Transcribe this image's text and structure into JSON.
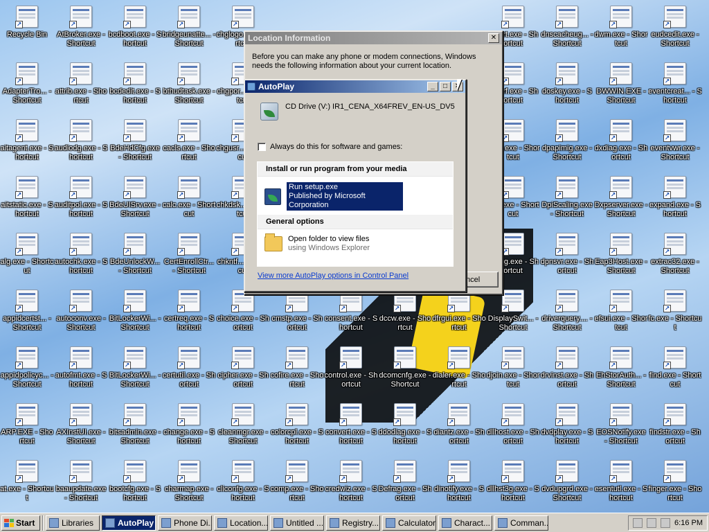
{
  "desktop": {
    "icons": [
      {
        "name": "recycle-bin",
        "label": "Recycle Bin"
      },
      {
        "name": "atbroker",
        "label": "AtBroker.exe - Shortcut"
      },
      {
        "name": "bcdboot",
        "label": "bcdboot.exe - Shortcut"
      },
      {
        "name": "bridgeunattend",
        "label": "bridgeunatte... - Shortcut"
      },
      {
        "name": "chglogon",
        "label": "chglogo... - Shortcut"
      },
      {
        "name": "adapter",
        "label": "AdapterTro... - Shortcut"
      },
      {
        "name": "attrib",
        "label": "attrib.exe - Shortcut"
      },
      {
        "name": "bcdedit",
        "label": "bcdedit.exe - Shortcut"
      },
      {
        "name": "bthudtask",
        "label": "bthudtask.exe - Shortcut"
      },
      {
        "name": "chgport",
        "label": "chgpor... - Shortcut"
      },
      {
        "name": "aitagent",
        "label": "aitagent.exe - Shortcut"
      },
      {
        "name": "audiodg",
        "label": "audiodg.exe - Shortcut"
      },
      {
        "name": "bdehdcfg",
        "label": "BdeHdCfg.exe - Shortcut"
      },
      {
        "name": "cacls",
        "label": "cacls.exe - Shortcut"
      },
      {
        "name": "chgusr",
        "label": "chgusr... - Shortcut"
      },
      {
        "name": "aitstatic",
        "label": "aitstatic.exe - Shortcut"
      },
      {
        "name": "auditpol",
        "label": "auditpol.exe - Shortcut"
      },
      {
        "name": "bdeuisrv",
        "label": "BdeUISrv.exe - Shortcut"
      },
      {
        "name": "calc",
        "label": "calc.exe - Shortcut"
      },
      {
        "name": "chkdsk",
        "label": "chkdsk... - Shortcut"
      },
      {
        "name": "alg",
        "label": "alg.exe - Shortcut"
      },
      {
        "name": "autochk",
        "label": "autochk.exe - Shortcut"
      },
      {
        "name": "bdeunlock",
        "label": "BdeUnlockW... - Shortcut"
      },
      {
        "name": "certenroll",
        "label": "CertEnrollCtr... - Shortcut"
      },
      {
        "name": "chkntfs",
        "label": "chkntf... - Shortcut"
      },
      {
        "name": "appidcertst",
        "label": "appidcertst... - Shortcut"
      },
      {
        "name": "autoconv",
        "label": "autoconv.exe - Shortcut"
      },
      {
        "name": "bitlockerw1",
        "label": "BitLockerWi... - Shortcut"
      },
      {
        "name": "certreq",
        "label": "certreq.exe - Shortcut"
      },
      {
        "name": "choice",
        "label": "choice.exe - Shortcut"
      },
      {
        "name": "cmstp",
        "label": "cmstp.exe - Shortcut"
      },
      {
        "name": "consent",
        "label": "consent.exe - Shortcut"
      },
      {
        "name": "dccw",
        "label": "dccw.exe - Shortcut"
      },
      {
        "name": "dfrgui",
        "label": "dfrgui.exe - Shortcut"
      },
      {
        "name": "displayswitch",
        "label": "DisplaySwit... - Shortcut"
      },
      {
        "name": "driverquery",
        "label": "driverquery.... - Shortcut"
      },
      {
        "name": "efsui",
        "label": "efsui.exe - Shortcut"
      },
      {
        "name": "fc",
        "label": "fc.exe - Shortcut"
      },
      {
        "name": "appidpolicy",
        "label": "appidpolicyc... - Shortcut"
      },
      {
        "name": "autofmt",
        "label": "autofmt.exe - Shortcut"
      },
      {
        "name": "bitlockerw2",
        "label": "BitLockerWi... - Shortcut"
      },
      {
        "name": "certutil",
        "label": "certutil.exe - Shortcut"
      },
      {
        "name": "cipher",
        "label": "cipher.exe - Shortcut"
      },
      {
        "name": "cofire",
        "label": "cofire.exe - Shortcut"
      },
      {
        "name": "control",
        "label": "control.exe - Shortcut"
      },
      {
        "name": "dcomcnfg",
        "label": "dcomcnfg.exe - Shortcut"
      },
      {
        "name": "dialer",
        "label": "dialer.exe - Shortcut"
      },
      {
        "name": "djoin",
        "label": "djoin.exe - Shortcut"
      },
      {
        "name": "drvinst",
        "label": "drvinst.exe - Shortcut"
      },
      {
        "name": "ehstorauth",
        "label": "EhStorAuth... - Shortcut"
      },
      {
        "name": "find",
        "label": "find.exe - Shortcut"
      },
      {
        "name": "arp",
        "label": "ARP.EXE - Shortcut"
      },
      {
        "name": "axinstui",
        "label": "AXInstUI.exe - Shortcut"
      },
      {
        "name": "bitsadmin",
        "label": "bitsadmin.exe - Shortcut"
      },
      {
        "name": "change",
        "label": "change.exe - Shortcut"
      },
      {
        "name": "cleanmgr",
        "label": "cleanmgr.exe - Shortcut"
      },
      {
        "name": "colorcpl",
        "label": "colorcpl.exe - Shortcut"
      },
      {
        "name": "convert",
        "label": "convert.exe - Shortcut"
      },
      {
        "name": "ddodiag",
        "label": "ddodiag.exe - Shortcut"
      },
      {
        "name": "diantz",
        "label": "diantz.exe - Shortcut"
      },
      {
        "name": "dllhost",
        "label": "dllhost.exe - Shortcut"
      },
      {
        "name": "dvdplay",
        "label": "dvdplay.exe - Shortcut"
      },
      {
        "name": "eosnotify",
        "label": "EOSNotify.exe - Shortcut"
      },
      {
        "name": "findstr",
        "label": "findstr.exe - Shortcut"
      },
      {
        "name": "at",
        "label": "at.exe - Shortcut"
      },
      {
        "name": "baaupdate",
        "label": "baaupdate.exe - Shortcut"
      },
      {
        "name": "bootcfg",
        "label": "bootcfg.exe - Shortcut"
      },
      {
        "name": "charmap",
        "label": "charmap.exe - Shortcut"
      },
      {
        "name": "cliconfg",
        "label": "cliconfg.exe - Shortcut"
      },
      {
        "name": "comp",
        "label": "comp.exe - Shortcut"
      },
      {
        "name": "credwiz",
        "label": "credwiz.exe - Shortcut"
      },
      {
        "name": "defrag",
        "label": "Defrag.exe - Shortcut"
      },
      {
        "name": "dinotify",
        "label": "dinotify.exe - Shortcut"
      },
      {
        "name": "dllhst3g",
        "label": "dllhst3g.exe - Shortcut"
      },
      {
        "name": "dvdupgrd",
        "label": "dvdupgrd.exe - Shortcut"
      },
      {
        "name": "esentutl",
        "label": "esentutl.exe - Shortcut"
      },
      {
        "name": "finger",
        "label": "finger.exe - Shortcut"
      },
      {
        "name": "smartcrt",
        "label": "...part.exe - Shortcut"
      },
      {
        "name": "dnscacheug",
        "label": "dnscacheug... - Shortcut"
      },
      {
        "name": "dwm",
        "label": "dwm.exe - Shortcut"
      },
      {
        "name": "eudcedit",
        "label": "eudcedit.exe - Shortcut"
      },
      {
        "name": "perf",
        "label": "...perf.exe - Shortcut"
      },
      {
        "name": "doskey",
        "label": "doskey.exe - Shortcut"
      },
      {
        "name": "dwwin",
        "label": "DWWIN.EXE - Shortcut"
      },
      {
        "name": "eventcreate",
        "label": "eventcreat... - Shortcut"
      },
      {
        "name": "aid",
        "label": "...aid.exe - Shortcut"
      },
      {
        "name": "dpapimig",
        "label": "dpapimig.exe - Shortcut"
      },
      {
        "name": "dxdiag",
        "label": "dxdiag.exe - Shortcut"
      },
      {
        "name": "eventvwr",
        "label": "eventvwr.exe - Shortcut"
      },
      {
        "name": "m",
        "label": "...m.exe - Shortcut"
      },
      {
        "name": "dpiscaling",
        "label": "DpiScaling.exe - Shortcut"
      },
      {
        "name": "dxpserver",
        "label": "Dxpserver.exe - Shortcut"
      },
      {
        "name": "expand",
        "label": "expand.exe - Shortcut"
      },
      {
        "name": "diag",
        "label": "...diag.exe - Shortcut"
      },
      {
        "name": "dpnsvr",
        "label": "dpnsvr.exe - Shortcut"
      },
      {
        "name": "eap3host",
        "label": "Eap3Host.exe - Shortcut"
      },
      {
        "name": "extrac32",
        "label": "extrac32.exe - Shortcut"
      }
    ]
  },
  "location_window": {
    "title": "Location Information",
    "body": "Before you can make any phone or modem connections, Windows needs the following information about your current location.",
    "cancel_label": "ncel",
    "close_glyph": "✕"
  },
  "autoplay": {
    "title": "AutoPlay",
    "drive_label": "CD Drive (V:) IR1_CENA_X64FREV_EN-US_DV5",
    "always_label": "Always do this for software and games:",
    "install_heading": "Install or run program from your media",
    "run_setup": "Run setup.exe",
    "publisher": "Published by Microsoft Corporation",
    "general_heading": "General options",
    "open_folder": "Open folder to view files",
    "open_folder_sub": "using Windows Explorer",
    "more_link": "View more AutoPlay options in Control Panel",
    "min_glyph": "_",
    "max_glyph": "□",
    "close_glyph": "✕"
  },
  "taskbar": {
    "start_label": "Start",
    "buttons": [
      {
        "label": "Libraries",
        "active": false
      },
      {
        "label": "AutoPlay",
        "active": true
      },
      {
        "label": "Phone Di...",
        "active": false
      },
      {
        "label": "Location...",
        "active": false
      },
      {
        "label": "Untitled ...",
        "active": false
      },
      {
        "label": "Registry...",
        "active": false
      },
      {
        "label": "Calculator",
        "active": false
      },
      {
        "label": "Charact...",
        "active": false
      },
      {
        "label": "Comman...",
        "active": false
      }
    ],
    "clock": "6:16 PM"
  }
}
